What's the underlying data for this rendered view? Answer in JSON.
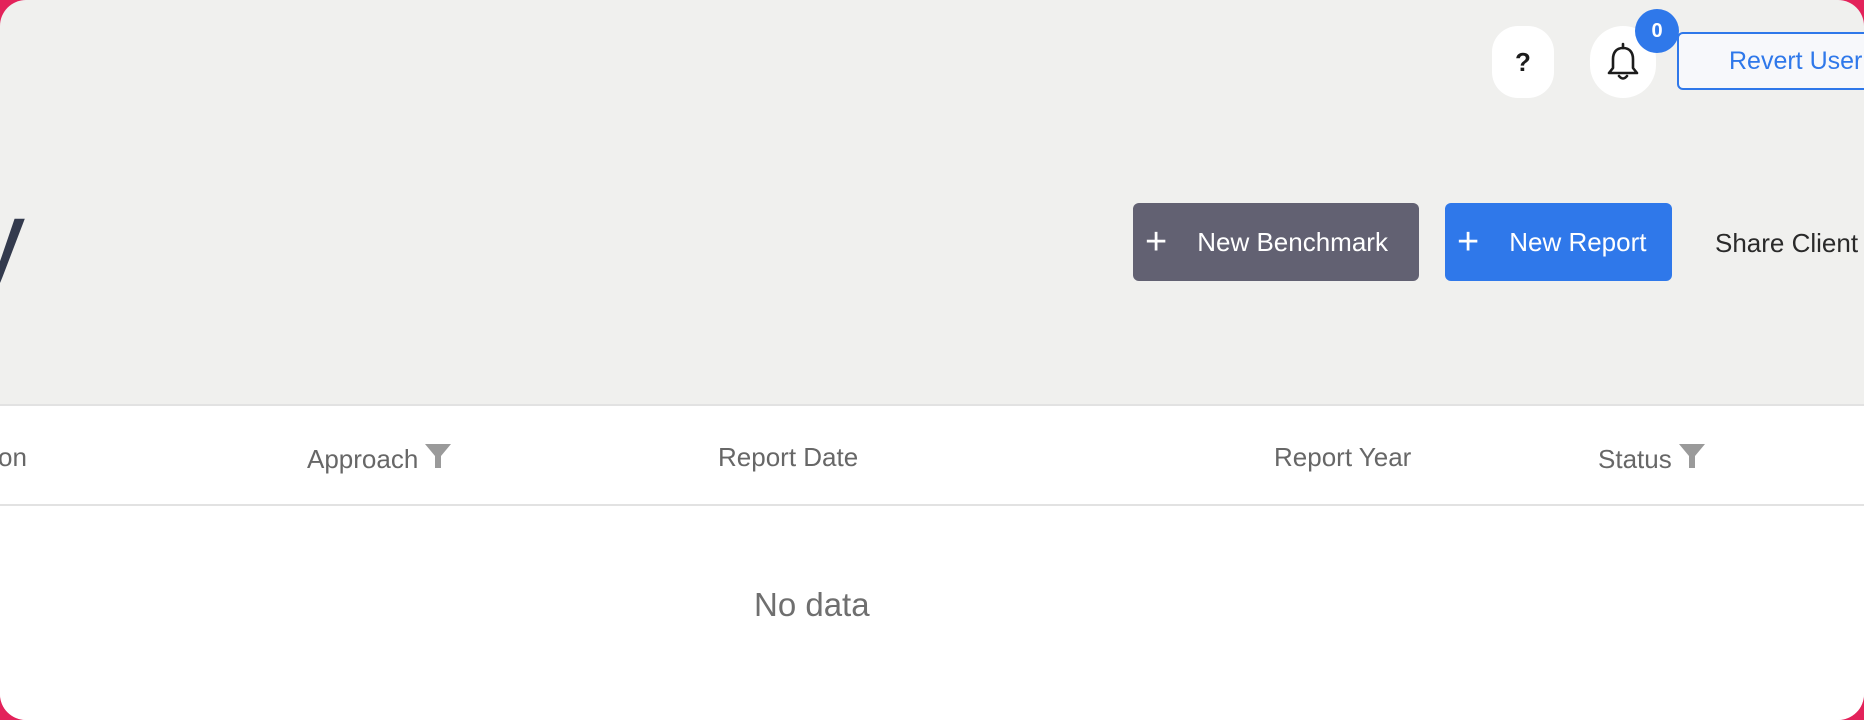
{
  "topbar": {
    "help_label": "?",
    "notification_count": "0",
    "revert_user_label": "Revert User"
  },
  "page": {
    "title_fragment": "y"
  },
  "actions": {
    "new_benchmark_label": "New Benchmark",
    "new_report_label": "New Report",
    "share_client_label": "Share Client",
    "plus_icon": "+"
  },
  "table": {
    "columns": [
      {
        "label": "on",
        "filterable": false
      },
      {
        "label": "Approach",
        "filterable": true
      },
      {
        "label": "Report Date",
        "filterable": false
      },
      {
        "label": "Report Year",
        "filterable": false
      },
      {
        "label": "Status",
        "filterable": true
      }
    ],
    "empty_text": "No data"
  },
  "colors": {
    "accent": "#2f78ea",
    "secondary_button": "#626172",
    "background": "#f0f0ee",
    "frame": "#e3225a"
  },
  "icons": [
    "help-icon",
    "bell-icon",
    "plus-icon",
    "filter-icon"
  ]
}
